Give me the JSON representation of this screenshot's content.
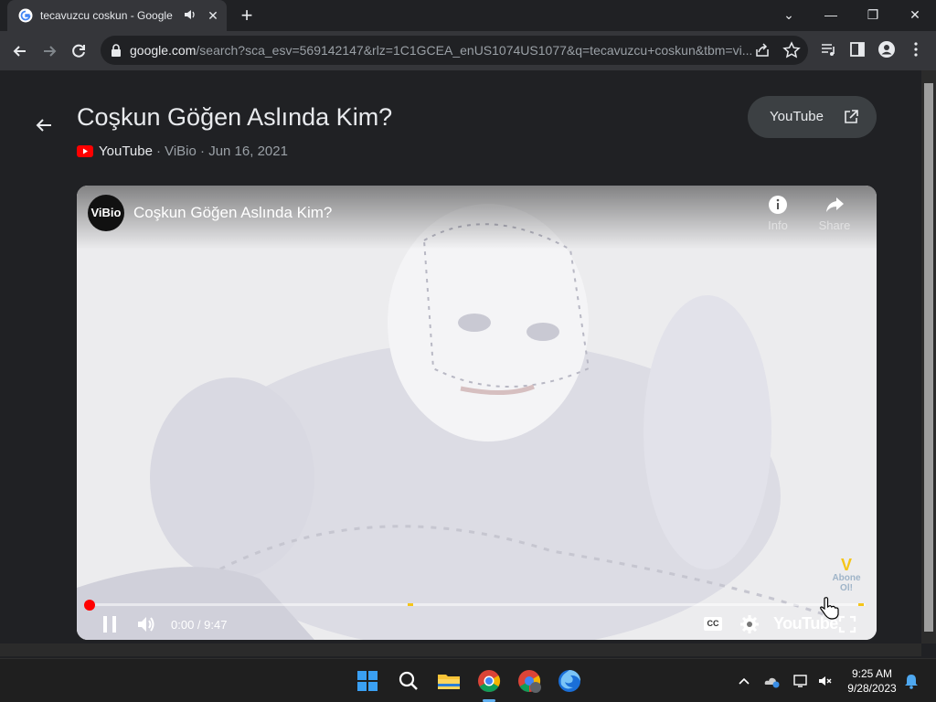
{
  "browser": {
    "tab": {
      "title": "tecavuzcu coskun - Google"
    },
    "url": {
      "host": "google.com",
      "rest": "/search?sca_esv=569142147&rlz=1C1GCEA_enUS1074US1077&q=tecavuzcu+coskun&tbm=vi..."
    }
  },
  "result": {
    "title": "Coşkun Göğen Aslında Kim?",
    "source": "YouTube",
    "meta_rest": "· ViBio · Jun 16, 2021",
    "open_button": "YouTube"
  },
  "video": {
    "channel_avatar_text": "ViBio",
    "title": "Coşkun Göğen Aslında Kim?",
    "info_label": "Info",
    "share_label": "Share",
    "time_current": "0:00",
    "time_total": "9:47",
    "timecode": "0:00 / 9:47",
    "progress_fraction": 0.0,
    "chapter_marker_fractions": [
      0.41,
      0.99
    ],
    "cc_label": "CC",
    "logo_text": "YouTube",
    "watermark_line1": "V",
    "watermark_line2": "Abone Ol!"
  },
  "taskbar": {
    "time": "9:25 AM",
    "date": "9/28/2023"
  },
  "colors": {
    "page_bg": "#202124",
    "toolbar_bg": "#35363a",
    "accent_red": "#ff0000",
    "marker_yellow": "#f5c518"
  }
}
